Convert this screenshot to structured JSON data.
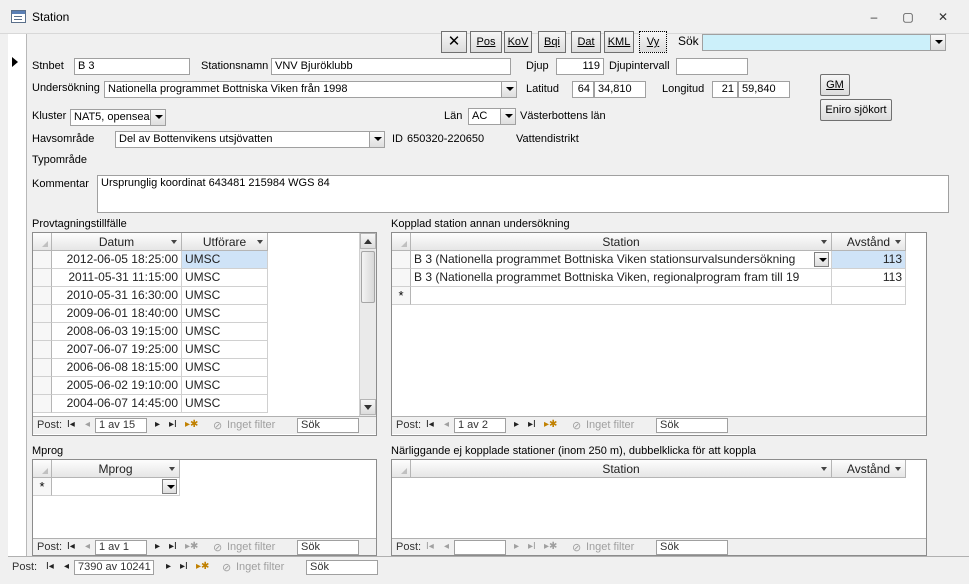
{
  "window": {
    "title": "Station",
    "minimize": "‒",
    "restore": "▢",
    "close": "✕"
  },
  "toolbar": {
    "close_x": "✕",
    "pos": "Pos",
    "kov": "KoV",
    "bqi": "Bqi",
    "dat": "Dat",
    "kml": "KML",
    "vy": "Vy",
    "search_label": "Sök",
    "search_value": ""
  },
  "fields": {
    "stnbet_label": "Stnbet",
    "stnbet": "B 3",
    "stationsnamn_label": "Stationsnamn",
    "stationsnamn": "VNV Bjuröklubb",
    "djup_label": "Djup",
    "djup": "119",
    "djupintervall_label": "Djupintervall",
    "djupintervall": "",
    "undersokning_label": "Undersökning",
    "undersokning": "Nationella programmet Bottniska Viken från 1998",
    "latitud_label": "Latitud",
    "lat_deg": "64",
    "lat_min": "34,810",
    "longitud_label": "Longitud",
    "lon_deg": "21",
    "lon_min": "59,840",
    "gm_button": "GM",
    "eniro_button": "Eniro sjökort",
    "kluster_label": "Kluster",
    "kluster": "NAT5, opensea",
    "lan_label": "Län",
    "lan": "AC",
    "lan_name": "Västerbottens län",
    "havsomrade_label": "Havsområde",
    "havsomrade": "Del av Bottenvikens utsjövatten",
    "id_label": "ID",
    "id": "650320-220650",
    "vattendistrikt_label": "Vattendistrikt",
    "typomrade_label": "Typområde",
    "kommentar_label": "Kommentar",
    "kommentar": "Ursprunglig koordinat 643481 215984 WGS 84"
  },
  "provtagning": {
    "title": "Provtagningstillfälle",
    "col_datum": "Datum",
    "col_utforare": "Utförare",
    "rows": [
      {
        "datum": "2012-06-05 18:25:00",
        "utforare": "UMSC"
      },
      {
        "datum": "2011-05-31 11:15:00",
        "utforare": "UMSC"
      },
      {
        "datum": "2010-05-31 16:30:00",
        "utforare": "UMSC"
      },
      {
        "datum": "2009-06-01 18:40:00",
        "utforare": "UMSC"
      },
      {
        "datum": "2008-06-03 19:15:00",
        "utforare": "UMSC"
      },
      {
        "datum": "2007-06-07 19:25:00",
        "utforare": "UMSC"
      },
      {
        "datum": "2006-06-08 18:15:00",
        "utforare": "UMSC"
      },
      {
        "datum": "2005-06-02 19:10:00",
        "utforare": "UMSC"
      },
      {
        "datum": "2004-06-07 14:45:00",
        "utforare": "UMSC"
      }
    ],
    "nav": {
      "post": "Post:",
      "pos": "1 av 15",
      "filter": "Inget filter",
      "sok": "Sök"
    }
  },
  "kopplad": {
    "title": "Kopplad station annan undersökning",
    "col_station": "Station",
    "col_avstand": "Avstånd",
    "rows": [
      {
        "station": "B 3 (Nationella programmet Bottniska Viken stationsurvalsundersökning",
        "avstand": "113"
      },
      {
        "station": "B 3 (Nationella programmet Bottniska Viken, regionalprogram fram till 19",
        "avstand": "113"
      }
    ],
    "new_row": "*",
    "nav": {
      "post": "Post:",
      "pos": "1 av 2",
      "filter": "Inget filter",
      "sok": "Sök"
    }
  },
  "mprog": {
    "title": "Mprog",
    "col_mprog": "Mprog",
    "new_row": "*",
    "nav": {
      "post": "Post:",
      "pos": "1 av 1",
      "filter": "Inget filter",
      "sok": "Sök"
    }
  },
  "narliggande": {
    "title": "Närliggande ej kopplade stationer (inom 250 m), dubbelklicka för att koppla",
    "col_station": "Station",
    "col_avstand": "Avstånd",
    "nav": {
      "post": "Post:",
      "pos": "",
      "filter": "Inget filter",
      "sok": "Sök"
    }
  },
  "mainnav": {
    "post": "Post:",
    "pos": "7390 av 10241",
    "filter": "Inget filter",
    "sok": "Sök"
  },
  "icons": {
    "first": "I◂",
    "prev": "◂",
    "next": "▸",
    "last": "▸I",
    "new": "▸✱",
    "filter": "⊘"
  }
}
